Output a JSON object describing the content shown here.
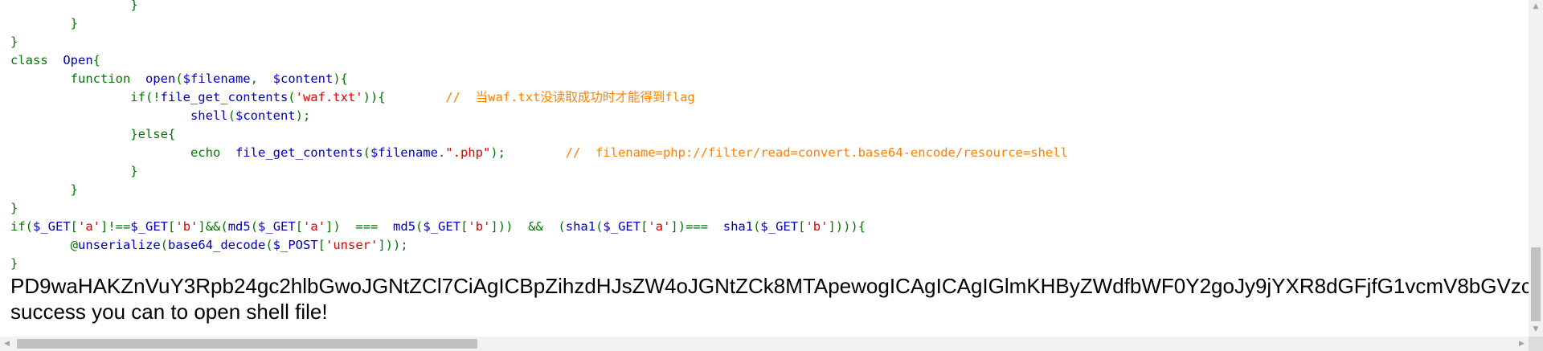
{
  "source_code": {
    "lines": [
      [
        {
          "t": "                ",
          "c": "plain"
        },
        {
          "t": "}",
          "c": "kw"
        }
      ],
      [
        {
          "t": "        ",
          "c": "plain"
        },
        {
          "t": "}",
          "c": "kw"
        }
      ],
      [
        {
          "t": "}",
          "c": "kw"
        }
      ],
      [
        {
          "t": "class ",
          "c": "kw"
        },
        {
          "t": " Open",
          "c": "def"
        },
        {
          "t": "{",
          "c": "kw"
        }
      ],
      [
        {
          "t": "        function ",
          "c": "kw"
        },
        {
          "t": " open",
          "c": "def"
        },
        {
          "t": "(",
          "c": "kw"
        },
        {
          "t": "$filename",
          "c": "def"
        },
        {
          "t": ",  ",
          "c": "kw"
        },
        {
          "t": "$content",
          "c": "def"
        },
        {
          "t": "){",
          "c": "kw"
        }
      ],
      [
        {
          "t": "                if(!",
          "c": "kw"
        },
        {
          "t": "file_get_contents",
          "c": "def"
        },
        {
          "t": "(",
          "c": "kw"
        },
        {
          "t": "'waf.txt'",
          "c": "str"
        },
        {
          "t": ")){        ",
          "c": "kw"
        },
        {
          "t": "//  当waf.txt没读取成功时才能得到flag",
          "c": "cmt"
        }
      ],
      [
        {
          "t": "                        ",
          "c": "plain"
        },
        {
          "t": "shell",
          "c": "def"
        },
        {
          "t": "(",
          "c": "kw"
        },
        {
          "t": "$content",
          "c": "def"
        },
        {
          "t": ");",
          "c": "kw"
        }
      ],
      [
        {
          "t": "                }else{",
          "c": "kw"
        }
      ],
      [
        {
          "t": "                        echo  ",
          "c": "kw"
        },
        {
          "t": "file_get_contents",
          "c": "def"
        },
        {
          "t": "(",
          "c": "kw"
        },
        {
          "t": "$filename",
          "c": "def"
        },
        {
          "t": ".",
          "c": "kw"
        },
        {
          "t": "\".php\"",
          "c": "str"
        },
        {
          "t": ");        ",
          "c": "kw"
        },
        {
          "t": "//  filename=php://filter/read=convert.base64-encode/resource=shell",
          "c": "cmt"
        }
      ],
      [
        {
          "t": "                }",
          "c": "kw"
        }
      ],
      [
        {
          "t": "        }",
          "c": "kw"
        }
      ],
      [
        {
          "t": "}",
          "c": "kw"
        }
      ],
      [
        {
          "t": "if(",
          "c": "kw"
        },
        {
          "t": "$_GET",
          "c": "def"
        },
        {
          "t": "[",
          "c": "kw"
        },
        {
          "t": "'a'",
          "c": "str"
        },
        {
          "t": "]!==",
          "c": "kw"
        },
        {
          "t": "$_GET",
          "c": "def"
        },
        {
          "t": "[",
          "c": "kw"
        },
        {
          "t": "'b'",
          "c": "str"
        },
        {
          "t": "]&&(",
          "c": "kw"
        },
        {
          "t": "md5",
          "c": "def"
        },
        {
          "t": "(",
          "c": "kw"
        },
        {
          "t": "$_GET",
          "c": "def"
        },
        {
          "t": "[",
          "c": "kw"
        },
        {
          "t": "'a'",
          "c": "str"
        },
        {
          "t": "])  ===  ",
          "c": "kw"
        },
        {
          "t": "md5",
          "c": "def"
        },
        {
          "t": "(",
          "c": "kw"
        },
        {
          "t": "$_GET",
          "c": "def"
        },
        {
          "t": "[",
          "c": "kw"
        },
        {
          "t": "'b'",
          "c": "str"
        },
        {
          "t": "]))  &&  (",
          "c": "kw"
        },
        {
          "t": "sha1",
          "c": "def"
        },
        {
          "t": "(",
          "c": "kw"
        },
        {
          "t": "$_GET",
          "c": "def"
        },
        {
          "t": "[",
          "c": "kw"
        },
        {
          "t": "'a'",
          "c": "str"
        },
        {
          "t": "])===  ",
          "c": "kw"
        },
        {
          "t": "sha1",
          "c": "def"
        },
        {
          "t": "(",
          "c": "kw"
        },
        {
          "t": "$_GET",
          "c": "def"
        },
        {
          "t": "[",
          "c": "kw"
        },
        {
          "t": "'b'",
          "c": "str"
        },
        {
          "t": "]))){",
          "c": "kw"
        }
      ],
      [
        {
          "t": "        @",
          "c": "kw"
        },
        {
          "t": "unserialize",
          "c": "def"
        },
        {
          "t": "(",
          "c": "kw"
        },
        {
          "t": "base64_decode",
          "c": "def"
        },
        {
          "t": "(",
          "c": "kw"
        },
        {
          "t": "$_POST",
          "c": "def"
        },
        {
          "t": "[",
          "c": "kw"
        },
        {
          "t": "'unser'",
          "c": "str"
        },
        {
          "t": "]));",
          "c": "kw"
        }
      ],
      [
        {
          "t": "}",
          "c": "kw"
        }
      ]
    ]
  },
  "output": {
    "base64_line": "PD9waHAKZnVuY3Rpb24gc2hlbGwoJGNtZCl7CiAgICBpZihzdHJsZW4oJGNtZCk8MTApewogICAgICAgIGlmKHByZWdfbWF0Y2goJy9jYXR8dGFjfG1vcmV8bGVzc",
    "message": "success you can to open shell file!"
  },
  "scrollbars": {
    "up_arrow": "▲",
    "down_arrow": "▼",
    "left_arrow": "◀",
    "right_arrow": "▶"
  },
  "colors": {
    "keyword": "#007700",
    "string": "#dd0000",
    "comment": "#ff8000",
    "default": "#0000bb"
  }
}
